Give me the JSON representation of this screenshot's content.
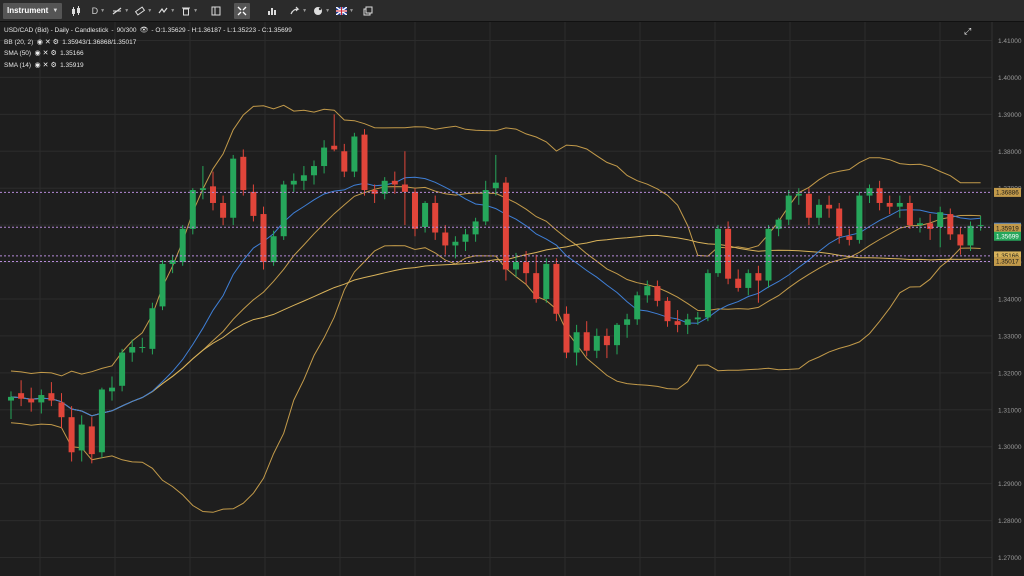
{
  "toolbar": {
    "instrument_label": "Instrument",
    "timeframe_label": "D",
    "icons": [
      "candles-icon",
      "draw-line-icon",
      "ruler-icon",
      "indicators-icon",
      "delete-icon",
      "layout-icon",
      "crosshair-icon",
      "chart-type-icon",
      "share-icon",
      "theme-icon",
      "language-flag-icon",
      "popout-icon"
    ]
  },
  "info": {
    "header": "USD/CAD (Bid) - Daily - Candlestick",
    "bars": "90/300",
    "ohlc": "- O:1.35629 - H:1.36187 - L:1.35223 - C:1.35699",
    "bb_label": "BB (20, 2)",
    "bb_values": "1.35943/1.36868/1.35017",
    "sma50_label": "SMA (50)",
    "sma50_value": "1.35166",
    "sma14_label": "SMA (14)",
    "sma14_value": "1.35919"
  },
  "colors": {
    "bg": "#1e1e1e",
    "grid": "#2c2c2c",
    "up": "#26a65b",
    "down": "#e0453a",
    "bb": "#c29a4a",
    "sma50": "#d8b25a",
    "sma14": "#3f7fd6",
    "marker": "#b58ad8",
    "axis_text": "#9a9a9a"
  },
  "chart_data": {
    "type": "candlestick",
    "ylim": [
      1.265,
      1.415
    ],
    "yticks": [
      "1.27000",
      "1.28000",
      "1.29000",
      "1.30000",
      "1.31000",
      "1.32000",
      "1.33000",
      "1.34000",
      "1.35000",
      "1.36000",
      "1.37000",
      "1.38000",
      "1.39000",
      "1.40000",
      "1.41000"
    ],
    "candles": [
      [
        1.3125,
        1.315,
        1.3075,
        1.3135
      ],
      [
        1.3145,
        1.318,
        1.311,
        1.313
      ],
      [
        1.313,
        1.316,
        1.3095,
        1.312
      ],
      [
        1.312,
        1.3155,
        1.309,
        1.314
      ],
      [
        1.3145,
        1.3175,
        1.311,
        1.3125
      ],
      [
        1.312,
        1.3145,
        1.305,
        1.308
      ],
      [
        1.308,
        1.311,
        1.296,
        1.2985
      ],
      [
        1.299,
        1.3085,
        1.296,
        1.306
      ],
      [
        1.3055,
        1.308,
        1.2955,
        1.298
      ],
      [
        1.2985,
        1.316,
        1.297,
        1.3155
      ],
      [
        1.315,
        1.319,
        1.3125,
        1.316
      ],
      [
        1.3165,
        1.3265,
        1.315,
        1.3255
      ],
      [
        1.3255,
        1.329,
        1.323,
        1.327
      ],
      [
        1.327,
        1.3295,
        1.3255,
        1.327
      ],
      [
        1.3265,
        1.339,
        1.325,
        1.3375
      ],
      [
        1.338,
        1.3505,
        1.337,
        1.3495
      ],
      [
        1.3495,
        1.352,
        1.347,
        1.3505
      ],
      [
        1.35,
        1.36,
        1.349,
        1.359
      ],
      [
        1.359,
        1.37,
        1.3575,
        1.3695
      ],
      [
        1.3695,
        1.376,
        1.367,
        1.37
      ],
      [
        1.3705,
        1.3745,
        1.364,
        1.366
      ],
      [
        1.366,
        1.368,
        1.36,
        1.362
      ],
      [
        1.362,
        1.379,
        1.36,
        1.378
      ],
      [
        1.3785,
        1.3805,
        1.368,
        1.3695
      ],
      [
        1.369,
        1.371,
        1.361,
        1.3625
      ],
      [
        1.363,
        1.365,
        1.348,
        1.35
      ],
      [
        1.35,
        1.3585,
        1.349,
        1.357
      ],
      [
        1.357,
        1.372,
        1.356,
        1.371
      ],
      [
        1.371,
        1.374,
        1.369,
        1.372
      ],
      [
        1.372,
        1.376,
        1.3695,
        1.3735
      ],
      [
        1.3735,
        1.3775,
        1.371,
        1.376
      ],
      [
        1.376,
        1.383,
        1.374,
        1.381
      ],
      [
        1.3815,
        1.39,
        1.38,
        1.3805
      ],
      [
        1.38,
        1.382,
        1.373,
        1.3745
      ],
      [
        1.3745,
        1.385,
        1.373,
        1.384
      ],
      [
        1.3845,
        1.386,
        1.368,
        1.3695
      ],
      [
        1.3695,
        1.371,
        1.366,
        1.3685
      ],
      [
        1.3685,
        1.373,
        1.367,
        1.372
      ],
      [
        1.372,
        1.3745,
        1.3685,
        1.371
      ],
      [
        1.371,
        1.38,
        1.36,
        1.369
      ],
      [
        1.369,
        1.37,
        1.357,
        1.359
      ],
      [
        1.3595,
        1.3665,
        1.358,
        1.366
      ],
      [
        1.366,
        1.368,
        1.356,
        1.358
      ],
      [
        1.358,
        1.36,
        1.352,
        1.3545
      ],
      [
        1.3545,
        1.357,
        1.351,
        1.3555
      ],
      [
        1.3555,
        1.359,
        1.353,
        1.3575
      ],
      [
        1.3575,
        1.362,
        1.3555,
        1.361
      ],
      [
        1.361,
        1.372,
        1.36,
        1.3695
      ],
      [
        1.37,
        1.379,
        1.368,
        1.3715
      ],
      [
        1.3715,
        1.373,
        1.345,
        1.348
      ],
      [
        1.348,
        1.3525,
        1.346,
        1.35
      ],
      [
        1.35,
        1.353,
        1.344,
        1.347
      ],
      [
        1.347,
        1.352,
        1.339,
        1.34
      ],
      [
        1.34,
        1.351,
        1.339,
        1.3495
      ],
      [
        1.3495,
        1.351,
        1.334,
        1.336
      ],
      [
        1.336,
        1.338,
        1.324,
        1.3255
      ],
      [
        1.3255,
        1.333,
        1.322,
        1.331
      ],
      [
        1.331,
        1.334,
        1.3245,
        1.326
      ],
      [
        1.326,
        1.332,
        1.324,
        1.33
      ],
      [
        1.33,
        1.332,
        1.324,
        1.3275
      ],
      [
        1.3275,
        1.3335,
        1.325,
        1.333
      ],
      [
        1.333,
        1.336,
        1.3295,
        1.3345
      ],
      [
        1.3345,
        1.342,
        1.333,
        1.341
      ],
      [
        1.341,
        1.345,
        1.339,
        1.3435
      ],
      [
        1.3435,
        1.345,
        1.338,
        1.3395
      ],
      [
        1.3395,
        1.3405,
        1.3325,
        1.334
      ],
      [
        1.334,
        1.337,
        1.331,
        1.333
      ],
      [
        1.333,
        1.336,
        1.3305,
        1.3345
      ],
      [
        1.3345,
        1.3365,
        1.333,
        1.335
      ],
      [
        1.335,
        1.348,
        1.334,
        1.347
      ],
      [
        1.347,
        1.36,
        1.346,
        1.359
      ],
      [
        1.359,
        1.361,
        1.344,
        1.3455
      ],
      [
        1.3455,
        1.348,
        1.342,
        1.343
      ],
      [
        1.343,
        1.348,
        1.341,
        1.347
      ],
      [
        1.347,
        1.349,
        1.339,
        1.345
      ],
      [
        1.345,
        1.36,
        1.343,
        1.359
      ],
      [
        1.359,
        1.362,
        1.357,
        1.3615
      ],
      [
        1.3615,
        1.3695,
        1.36,
        1.368
      ],
      [
        1.368,
        1.37,
        1.3655,
        1.3685
      ],
      [
        1.3685,
        1.37,
        1.36,
        1.362
      ],
      [
        1.362,
        1.367,
        1.36,
        1.3655
      ],
      [
        1.3655,
        1.368,
        1.362,
        1.3645
      ],
      [
        1.3645,
        1.366,
        1.355,
        1.357
      ],
      [
        1.357,
        1.359,
        1.3545,
        1.356
      ],
      [
        1.356,
        1.369,
        1.355,
        1.368
      ],
      [
        1.368,
        1.371,
        1.366,
        1.37
      ],
      [
        1.37,
        1.372,
        1.364,
        1.366
      ],
      [
        1.366,
        1.368,
        1.363,
        1.365
      ],
      [
        1.365,
        1.368,
        1.362,
        1.366
      ],
      [
        1.366,
        1.368,
        1.359,
        1.36
      ],
      [
        1.36,
        1.362,
        1.358,
        1.3605
      ],
      [
        1.3605,
        1.363,
        1.356,
        1.359
      ],
      [
        1.3595,
        1.365,
        1.354,
        1.3635
      ],
      [
        1.363,
        1.3645,
        1.356,
        1.3575
      ],
      [
        1.3575,
        1.3595,
        1.352,
        1.3545
      ],
      [
        1.3545,
        1.361,
        1.353,
        1.3598
      ],
      [
        1.3598,
        1.3625,
        1.3585,
        1.36
      ]
    ],
    "markers": [
      {
        "value": 1.36886,
        "label": "1.36886",
        "color": "#c29a4a",
        "text": "#1a1a1a"
      },
      {
        "value": 1.35943,
        "label": "1.35943",
        "color": "#3f7fd6",
        "text": "#ffffff"
      },
      {
        "value": 1.35919,
        "label": "1.35919",
        "color": "#c29a4a",
        "text": "#1a1a1a"
      },
      {
        "value": 1.35699,
        "label": "1.35699",
        "color": "#26a65b",
        "text": "#ffffff"
      },
      {
        "value": 1.35166,
        "label": "1.35166",
        "color": "#d8b25a",
        "text": "#1a1a1a"
      },
      {
        "value": 1.35017,
        "label": "1.35017",
        "color": "#c29a4a",
        "text": "#1a1a1a"
      }
    ]
  }
}
